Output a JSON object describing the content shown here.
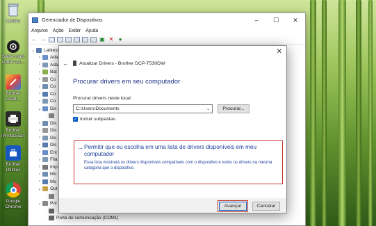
{
  "desktop": {
    "icons": [
      {
        "label": "Lixeira",
        "icon": "recycle-bin-icon"
      },
      {
        "label": "Saiba mais sobre est...",
        "icon": "camera-icon"
      },
      {
        "label": "Brother Creati...",
        "icon": "brother-creative-icon"
      },
      {
        "label": "Brother iPrint&Scan",
        "icon": "printer-icon"
      },
      {
        "label": "Brother Utilities",
        "icon": "toolbox-icon"
      },
      {
        "label": "Google Chrome",
        "icon": "chrome-icon"
      }
    ]
  },
  "device_manager": {
    "title": "Gerenciador de Dispositivos",
    "menu": [
      "Arquivo",
      "Ação",
      "Exibir",
      "Ajuda"
    ],
    "tree": [
      {
        "text": "Labtest",
        "expander": "⌄"
      },
      {
        "text": "Ada",
        "expander": "›"
      },
      {
        "text": "Ada",
        "expander": "›"
      },
      {
        "text": "Bat",
        "expander": "›"
      },
      {
        "text": "Co",
        "expander": "›"
      },
      {
        "text": "Co",
        "expander": "›"
      },
      {
        "text": "Co",
        "expander": "›"
      },
      {
        "text": "Co",
        "expander": "›"
      },
      {
        "text": "Dis",
        "expander": "⌄"
      },
      {
        "text": "",
        "expander": ""
      },
      {
        "text": "Dis",
        "expander": "›"
      },
      {
        "text": "Dis",
        "expander": "›"
      },
      {
        "text": "Dis",
        "expander": "›"
      },
      {
        "text": "Dis",
        "expander": "›"
      },
      {
        "text": "Ent",
        "expander": "›"
      },
      {
        "text": "Fila",
        "expander": "›"
      },
      {
        "text": "Imp",
        "expander": "›"
      },
      {
        "text": "Mo",
        "expander": "›"
      },
      {
        "text": "Mo",
        "expander": "›"
      },
      {
        "text": "Out",
        "expander": "⌄"
      },
      {
        "text": "",
        "expander": ""
      },
      {
        "text": "Por",
        "expander": "⌄"
      },
      {
        "text": "",
        "expander": ""
      },
      {
        "text": "Porta de comunicação (COM1)",
        "expander": ""
      }
    ]
  },
  "dialog": {
    "header": "Atualizar Drivers - Brother DCP-T530DW",
    "heading": "Procurar drivers em seu computador",
    "search_label": "Procurar drivers neste local:",
    "path_value": "C:\\Users\\Documents",
    "browse_button": "Procurar...",
    "include_subfolders": "Incluir subpastas",
    "option_title": "Permitir que eu escolha em uma lista de drivers disponíveis em meu computador",
    "option_desc": "Essa lista mostrará os drivers disponíveis compatíveis com o dispositivo e todos os drivers na mesma categoria que o dispositivo.",
    "next_button": "Avançar",
    "cancel_button": "Cancelar"
  },
  "colors": {
    "accent_blue": "#1a3d9c",
    "highlight_red": "#c0392b",
    "checkbox_blue": "#0b5fc4"
  }
}
